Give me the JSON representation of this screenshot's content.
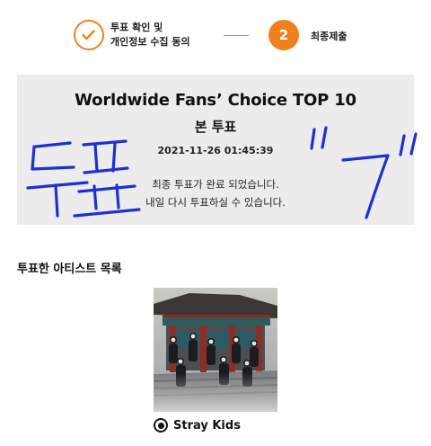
{
  "stepper": {
    "step1": {
      "label_line1": "투표 확인 및",
      "label_line2": "개인정보 수집 동의",
      "icon": "check-icon"
    },
    "step2": {
      "number": "2",
      "label": "최종제출"
    },
    "accent_color": "#f0801e"
  },
  "result": {
    "title": "Worldwide Fans’ Choice TOP 10",
    "subtitle": "본 투표",
    "timestamp": "2021-11-26 01:45:39",
    "message_line1": "최종 투표가 완료 되었습니다.",
    "message_line2": "내일 다시 투표하실 수 있습니다.",
    "handwriting": "투표 \"7\"",
    "handwriting_color": "#1f2fd6"
  },
  "artists": {
    "section_title": "투표한 아티스트 목록",
    "items": [
      {
        "name": "Stray Kids",
        "selected": true
      }
    ]
  }
}
